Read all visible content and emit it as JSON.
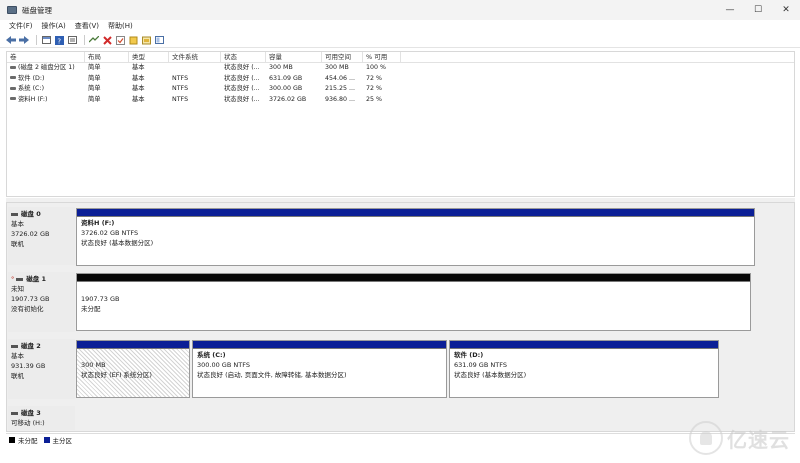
{
  "window": {
    "title": "磁盘管理",
    "controls": {
      "minimize": "—",
      "maximize": "☐",
      "close": "✕"
    }
  },
  "menu": [
    "文件(F)",
    "操作(A)",
    "查看(V)",
    "帮助(H)"
  ],
  "toolbar_icons": [
    "back-icon",
    "forward-icon",
    "properties-icon",
    "help-icon",
    "list-icon",
    "connect-icon",
    "delete-icon",
    "check-icon",
    "new-icon",
    "rescan-icon",
    "view-icon"
  ],
  "volume_table": {
    "headers": [
      "卷",
      "布局",
      "类型",
      "文件系统",
      "状态",
      "容量",
      "可用空间",
      "% 可用"
    ],
    "rows": [
      [
        "(磁盘 2 磁盘分区 1)",
        "简单",
        "基本",
        "",
        "状态良好 (...",
        "300 MB",
        "300 MB",
        "100 %"
      ],
      [
        "软件 (D:)",
        "简单",
        "基本",
        "NTFS",
        "状态良好 (...",
        "631.09 GB",
        "454.06 ...",
        "72 %"
      ],
      [
        "系统 (C:)",
        "简单",
        "基本",
        "NTFS",
        "状态良好 (...",
        "300.00 GB",
        "215.25 ...",
        "72 %"
      ],
      [
        "资料H (F:)",
        "简单",
        "基本",
        "NTFS",
        "状态良好 (...",
        "3726.02 GB",
        "936.80 ...",
        "25 %"
      ]
    ]
  },
  "disks": [
    {
      "name": "磁盘 0",
      "type": "基本",
      "size": "3726.02 GB",
      "status": "联机",
      "partitions": [
        {
          "name": "资料H (F:)",
          "size_fs": "3726.02 GB NTFS",
          "status": "状态良好 (基本数据分区)"
        }
      ]
    },
    {
      "name": "磁盘 1",
      "type": "未知",
      "size": "1907.73 GB",
      "status": "没有初始化",
      "partitions": [
        {
          "name": "",
          "size_fs": "1907.73 GB",
          "status": "未分配"
        }
      ]
    },
    {
      "name": "磁盘 2",
      "type": "基本",
      "size": "931.39 GB",
      "status": "联机",
      "partitions": [
        {
          "name": "",
          "size_fs": "300 MB",
          "status": "状态良好 (EFI 系统分区)"
        },
        {
          "name": "系统 (C:)",
          "size_fs": "300.00 GB NTFS",
          "status": "状态良好 (启动, 页面文件, 故障转储, 基本数据分区)"
        },
        {
          "name": "软件 (D:)",
          "size_fs": "631.09 GB NTFS",
          "status": "状态良好 (基本数据分区)"
        }
      ]
    },
    {
      "name": "磁盘 3",
      "type": "可移动 (H:)",
      "size": "",
      "status": "",
      "partitions": []
    }
  ],
  "legend": [
    {
      "label": "未分配",
      "color": "#000000"
    },
    {
      "label": "主分区",
      "color": "#0b1f96"
    }
  ],
  "watermark": {
    "text": "亿速云"
  }
}
